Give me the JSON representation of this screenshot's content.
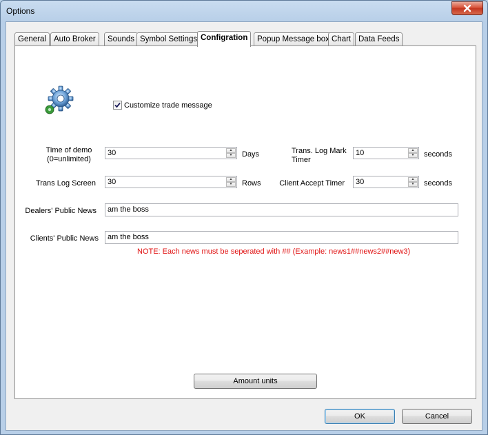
{
  "window": {
    "title": "Options",
    "close_label": "✕"
  },
  "tabs": [
    {
      "label": "General"
    },
    {
      "label": "Auto Broker"
    },
    {
      "label": "Sounds"
    },
    {
      "label": "Symbol Settings"
    },
    {
      "label": "Configration",
      "active": true
    },
    {
      "label": "Popup Message box"
    },
    {
      "label": "Chart"
    },
    {
      "label": "Data Feeds"
    }
  ],
  "config": {
    "customize_label": "Customize trade message",
    "customize_checked": true,
    "time_of_demo_label_1": "Time of demo",
    "time_of_demo_label_2": "(0=unlimited)",
    "time_of_demo_value": "30",
    "time_of_demo_unit": "Days",
    "trans_log_mark_label_1": "Trans. Log Mark",
    "trans_log_mark_label_2": "Timer",
    "trans_log_mark_value": "10",
    "trans_log_mark_unit": "seconds",
    "trans_log_screen_label": "Trans Log Screen",
    "trans_log_screen_value": "30",
    "trans_log_screen_unit": "Rows",
    "client_accept_label": "Client Accept Timer",
    "client_accept_value": "30",
    "client_accept_unit": "seconds",
    "dealers_news_label": "Dealers' Public News",
    "dealers_news_value": "am the boss",
    "clients_news_label": "Clients' Public News",
    "clients_news_value": "am the boss",
    "note": "NOTE: Each news must be seperated with ## (Example: news1##news2##new3)",
    "amount_units_label": "Amount units"
  },
  "footer": {
    "ok_label": "OK",
    "cancel_label": "Cancel"
  }
}
